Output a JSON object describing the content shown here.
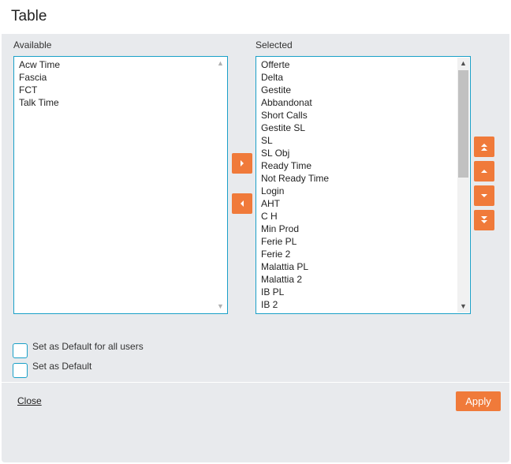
{
  "dialog": {
    "title": "Table"
  },
  "available": {
    "label": "Available",
    "items": [
      "Acw Time",
      "Fascia",
      "FCT",
      "Talk Time"
    ]
  },
  "selected": {
    "label": "Selected",
    "items": [
      "Offerte",
      "Delta",
      "Gestite",
      "Abbandonat",
      "Short Calls",
      "Gestite SL",
      "SL",
      "SL Obj",
      "Ready Time",
      "Not Ready Time",
      "Login",
      "AHT",
      "C H",
      "Min Prod",
      "Ferie PL",
      "Ferie 2",
      "Malattia PL",
      "Malattia 2",
      "IB PL",
      "IB 2"
    ]
  },
  "options": {
    "default_all_users_label": "Set as Default for all users",
    "default_all_users_checked": false,
    "default_label": "Set as Default",
    "default_checked": false
  },
  "footer": {
    "close_label": "Close",
    "apply_label": "Apply"
  },
  "colors": {
    "accent": "#f07a3a",
    "border": "#1aa0c8",
    "panel": "#e8eaed"
  }
}
